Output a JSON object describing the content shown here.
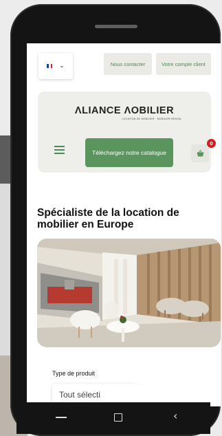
{
  "language_selector": {
    "flag_colors": [
      "#1f3e9c",
      "#ffffff",
      "#d8233a"
    ],
    "chevron": "chevron-down-icon"
  },
  "top_buttons": {
    "contact": "Nous contacter",
    "account": "Votre compte client"
  },
  "logo": {
    "name": "ΛLIANCE ΛOBILIER",
    "tagline": "LOCATION DE MOBILIER · MOBILIER RENTAL"
  },
  "header": {
    "catalogue_label": "Téléchargez notre catalogue",
    "cart_count": "0",
    "menu_icon": "hamburger-icon",
    "cart_icon": "cart-icon"
  },
  "headline": "Spécialiste de la location de mobilier en Europe",
  "form": {
    "product_type_label": "Type de produit",
    "product_type_value": "Tout sélecti"
  },
  "colors": {
    "accent_green": "#5b955e",
    "badge_red": "#d71d1d",
    "card_bg": "#eeefea"
  }
}
